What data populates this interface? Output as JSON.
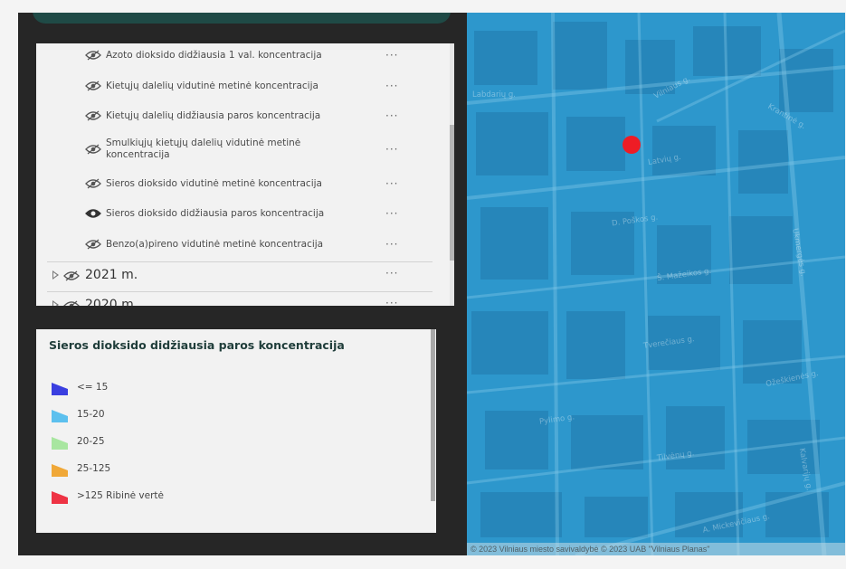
{
  "layer_list": {
    "layers": [
      {
        "label": "Azoto dioksido didžiausia 1 val. koncentracija",
        "visible": false,
        "menu": "···"
      },
      {
        "label": "Kietųjų dalelių vidutinė metinė koncentracija",
        "visible": false,
        "menu": "···"
      },
      {
        "label": "Kietųjų dalelių didžiausia paros koncentracija",
        "visible": false,
        "menu": "···"
      },
      {
        "label": "Smulkiųjų kietųjų dalelių vidutinė metinė koncentracija",
        "visible": false,
        "menu": "···"
      },
      {
        "label": "Sieros dioksido vidutinė metinė koncentracija",
        "visible": false,
        "menu": "···"
      },
      {
        "label": "Sieros dioksido didžiausia paros koncentracija",
        "visible": true,
        "menu": "···"
      },
      {
        "label": "Benzo(a)pireno vidutinė metinė koncentracija",
        "visible": false,
        "menu": "···"
      }
    ],
    "groups": [
      {
        "label": "2021 m.",
        "menu": "···"
      },
      {
        "label": "2020 m.",
        "menu": "···"
      }
    ]
  },
  "legend": {
    "title": "Sieros dioksido didžiausia paros koncentracija",
    "items": [
      {
        "label": "<= 15",
        "color": "#3a3fe0"
      },
      {
        "label": "15-20",
        "color": "#5cc0ee"
      },
      {
        "label": "20-25",
        "color": "#a8e6a0"
      },
      {
        "label": "25-125",
        "color": "#f0a838"
      },
      {
        "label": ">125 Ribinė vertė",
        "color": "#ee3344"
      }
    ]
  },
  "map": {
    "background_color": "#2d97cc",
    "marker_color": "#ee1c25",
    "street_labels": [
      "Labdarių g.",
      "Latvių g.",
      "Vilniaus g.",
      "D. Poškos g.",
      "Š. Mažeikos g.",
      "Tverečiaus g.",
      "Ukmergės g.",
      "Pylimo g.",
      "Tilvėnų g.",
      "Ožeškienės g.",
      "A. Mickevičiaus g.",
      "Kalvarijų g.",
      "Krantinė g."
    ],
    "attribution": "© 2023 Vilniaus miesto savivaldybė © 2023 UAB \"Vilniaus Planas\""
  }
}
